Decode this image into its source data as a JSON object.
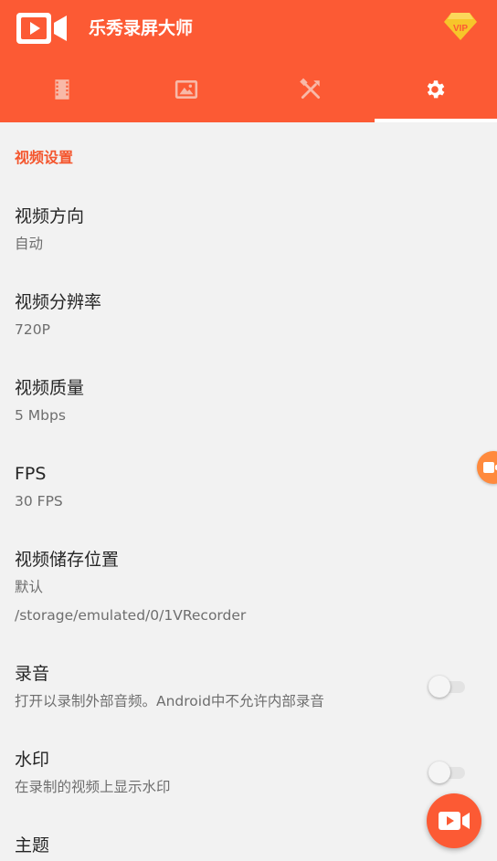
{
  "app": {
    "title": "乐秀录屏大师",
    "vip_label": "VIP"
  },
  "tabs": [
    {
      "icon": "film-icon"
    },
    {
      "icon": "image-icon"
    },
    {
      "icon": "tools-icon"
    },
    {
      "icon": "gear-icon",
      "selected": true
    }
  ],
  "section": {
    "title": "视频设置"
  },
  "settings": {
    "orientation": {
      "title": "视频方向",
      "value": "自动"
    },
    "resolution": {
      "title": "视频分辨率",
      "value": "720P"
    },
    "quality": {
      "title": "视频质量",
      "value": "5 Mbps"
    },
    "fps": {
      "title": "FPS",
      "value": "30 FPS"
    },
    "storage": {
      "title": "视频储存位置",
      "value": "默认",
      "path": "/storage/emulated/0/1VRecorder"
    },
    "audio": {
      "title": "录音",
      "description": "打开以录制外部音频。Android中不允许内部录音",
      "enabled": false
    },
    "watermark": {
      "title": "水印",
      "description": "在录制的视频上显示水印",
      "enabled": false
    },
    "theme": {
      "title": "主题"
    }
  },
  "colors": {
    "primary": "#fc5a34",
    "accent": "#f4562e",
    "background": "#f2f2f2"
  }
}
